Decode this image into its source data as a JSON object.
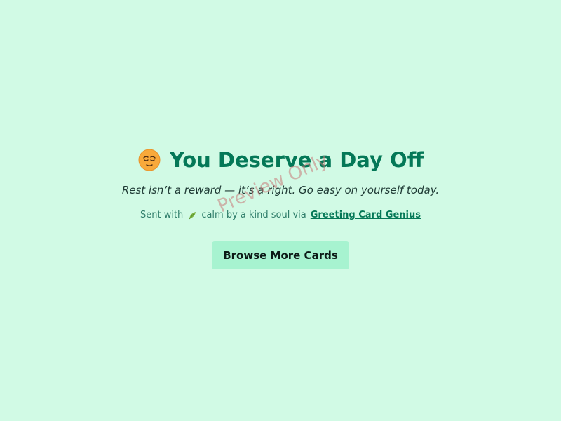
{
  "card": {
    "emoji_icon": "relieved-face-icon",
    "title": "You Deserve a Day Off",
    "message": "Rest isn’t a reward — it’s a right. Go easy on yourself today.",
    "sent_prefix": "Sent with",
    "sent_icon": "leaf-icon",
    "sent_middle": "calm by a kind soul via",
    "sent_link": "Greeting Card Genius",
    "cta_label": "Browse More Cards"
  },
  "watermark": "Preview Only",
  "colors": {
    "background": "#d1fae5",
    "title": "#047857",
    "button_bg": "#a7f3d0",
    "link": "#047857"
  }
}
